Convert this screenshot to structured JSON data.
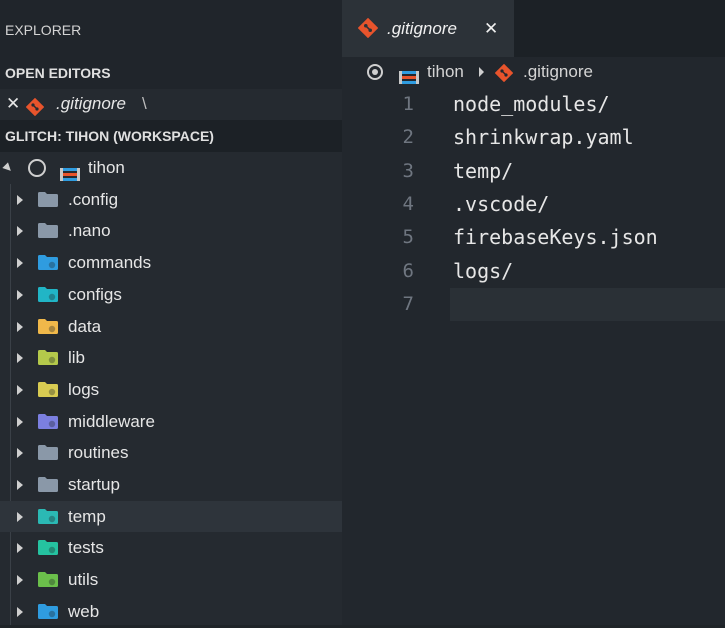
{
  "sidebar": {
    "title": "EXPLORER",
    "open_editors_header": "OPEN EDITORS",
    "open_editor": {
      "close": "✕",
      "name": ".gitignore",
      "path": "\\"
    },
    "workspace_header": "GLITCH: TIHON (WORKSPACE)",
    "root": {
      "label": "tihon"
    },
    "folders": [
      {
        "label": ".config",
        "icon": "folder-icon",
        "color": "#8a98a8"
      },
      {
        "label": ".nano",
        "icon": "folder-icon",
        "color": "#8a98a8"
      },
      {
        "label": "commands",
        "icon": "folder-commands-icon",
        "color": "#2f9ce0"
      },
      {
        "label": "configs",
        "icon": "folder-config-icon",
        "color": "#21b5c6"
      },
      {
        "label": "data",
        "icon": "folder-database-icon",
        "color": "#f0b84a"
      },
      {
        "label": "lib",
        "icon": "folder-lib-icon",
        "color": "#b4c94b"
      },
      {
        "label": "logs",
        "icon": "folder-log-icon",
        "color": "#d8cb52"
      },
      {
        "label": "middleware",
        "icon": "folder-middleware-icon",
        "color": "#7b7fe0"
      },
      {
        "label": "routines",
        "icon": "folder-icon",
        "color": "#8a98a8"
      },
      {
        "label": "startup",
        "icon": "folder-icon",
        "color": "#8a98a8"
      },
      {
        "label": "temp",
        "icon": "folder-temp-icon",
        "color": "#2bb9b4"
      },
      {
        "label": "tests",
        "icon": "folder-test-icon",
        "color": "#25c2a0"
      },
      {
        "label": "utils",
        "icon": "folder-utils-icon",
        "color": "#6bbf4b"
      },
      {
        "label": "web",
        "icon": "folder-web-icon",
        "color": "#2f9ce0"
      }
    ],
    "selected_folder": "temp"
  },
  "editor": {
    "tab": {
      "name": ".gitignore",
      "close": "✕"
    },
    "breadcrumb": [
      "tihon",
      ".gitignore"
    ],
    "lines": [
      {
        "n": "1",
        "text": "node_modules/"
      },
      {
        "n": "2",
        "text": "shrinkwrap.yaml"
      },
      {
        "n": "3",
        "text": "temp/"
      },
      {
        "n": "4",
        "text": ".vscode/"
      },
      {
        "n": "5",
        "text": "firebaseKeys.json"
      },
      {
        "n": "6",
        "text": "logs/"
      },
      {
        "n": "7",
        "text": ""
      }
    ],
    "current_line": "7"
  },
  "colors": {
    "git_icon": "#e8542c",
    "background": "#22272d",
    "sidebar": "#252a30"
  }
}
